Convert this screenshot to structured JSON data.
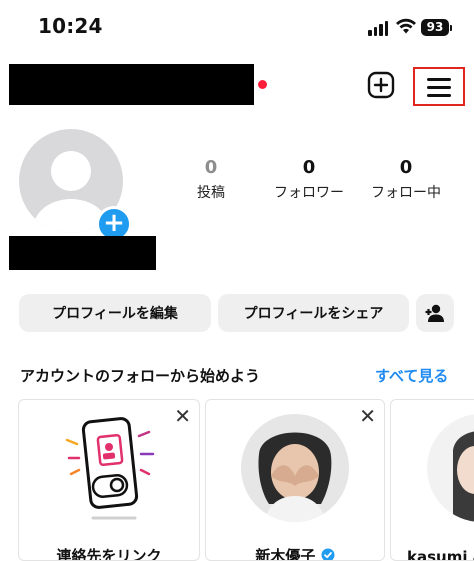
{
  "status_bar": {
    "time": "10:24",
    "battery": "93"
  },
  "profile": {
    "posts_count": "0",
    "posts_label": "投稿",
    "followers_count": "0",
    "followers_label": "フォロワー",
    "following_count": "0",
    "following_label": "フォロー中"
  },
  "actions": {
    "edit_profile": "プロフィールを編集",
    "share_profile": "プロフィールをシェア"
  },
  "suggestions": {
    "title": "アカウントのフォローから始めよう",
    "see_all": "すべて見る",
    "cards": [
      {
        "label": "連絡先をリンク"
      },
      {
        "label": "新木優子"
      },
      {
        "label": "kasumi a"
      }
    ]
  },
  "colors": {
    "accent": "#1f8bf0",
    "notification_dot": "#ff1d3a",
    "highlight_box": "#e0261f"
  }
}
